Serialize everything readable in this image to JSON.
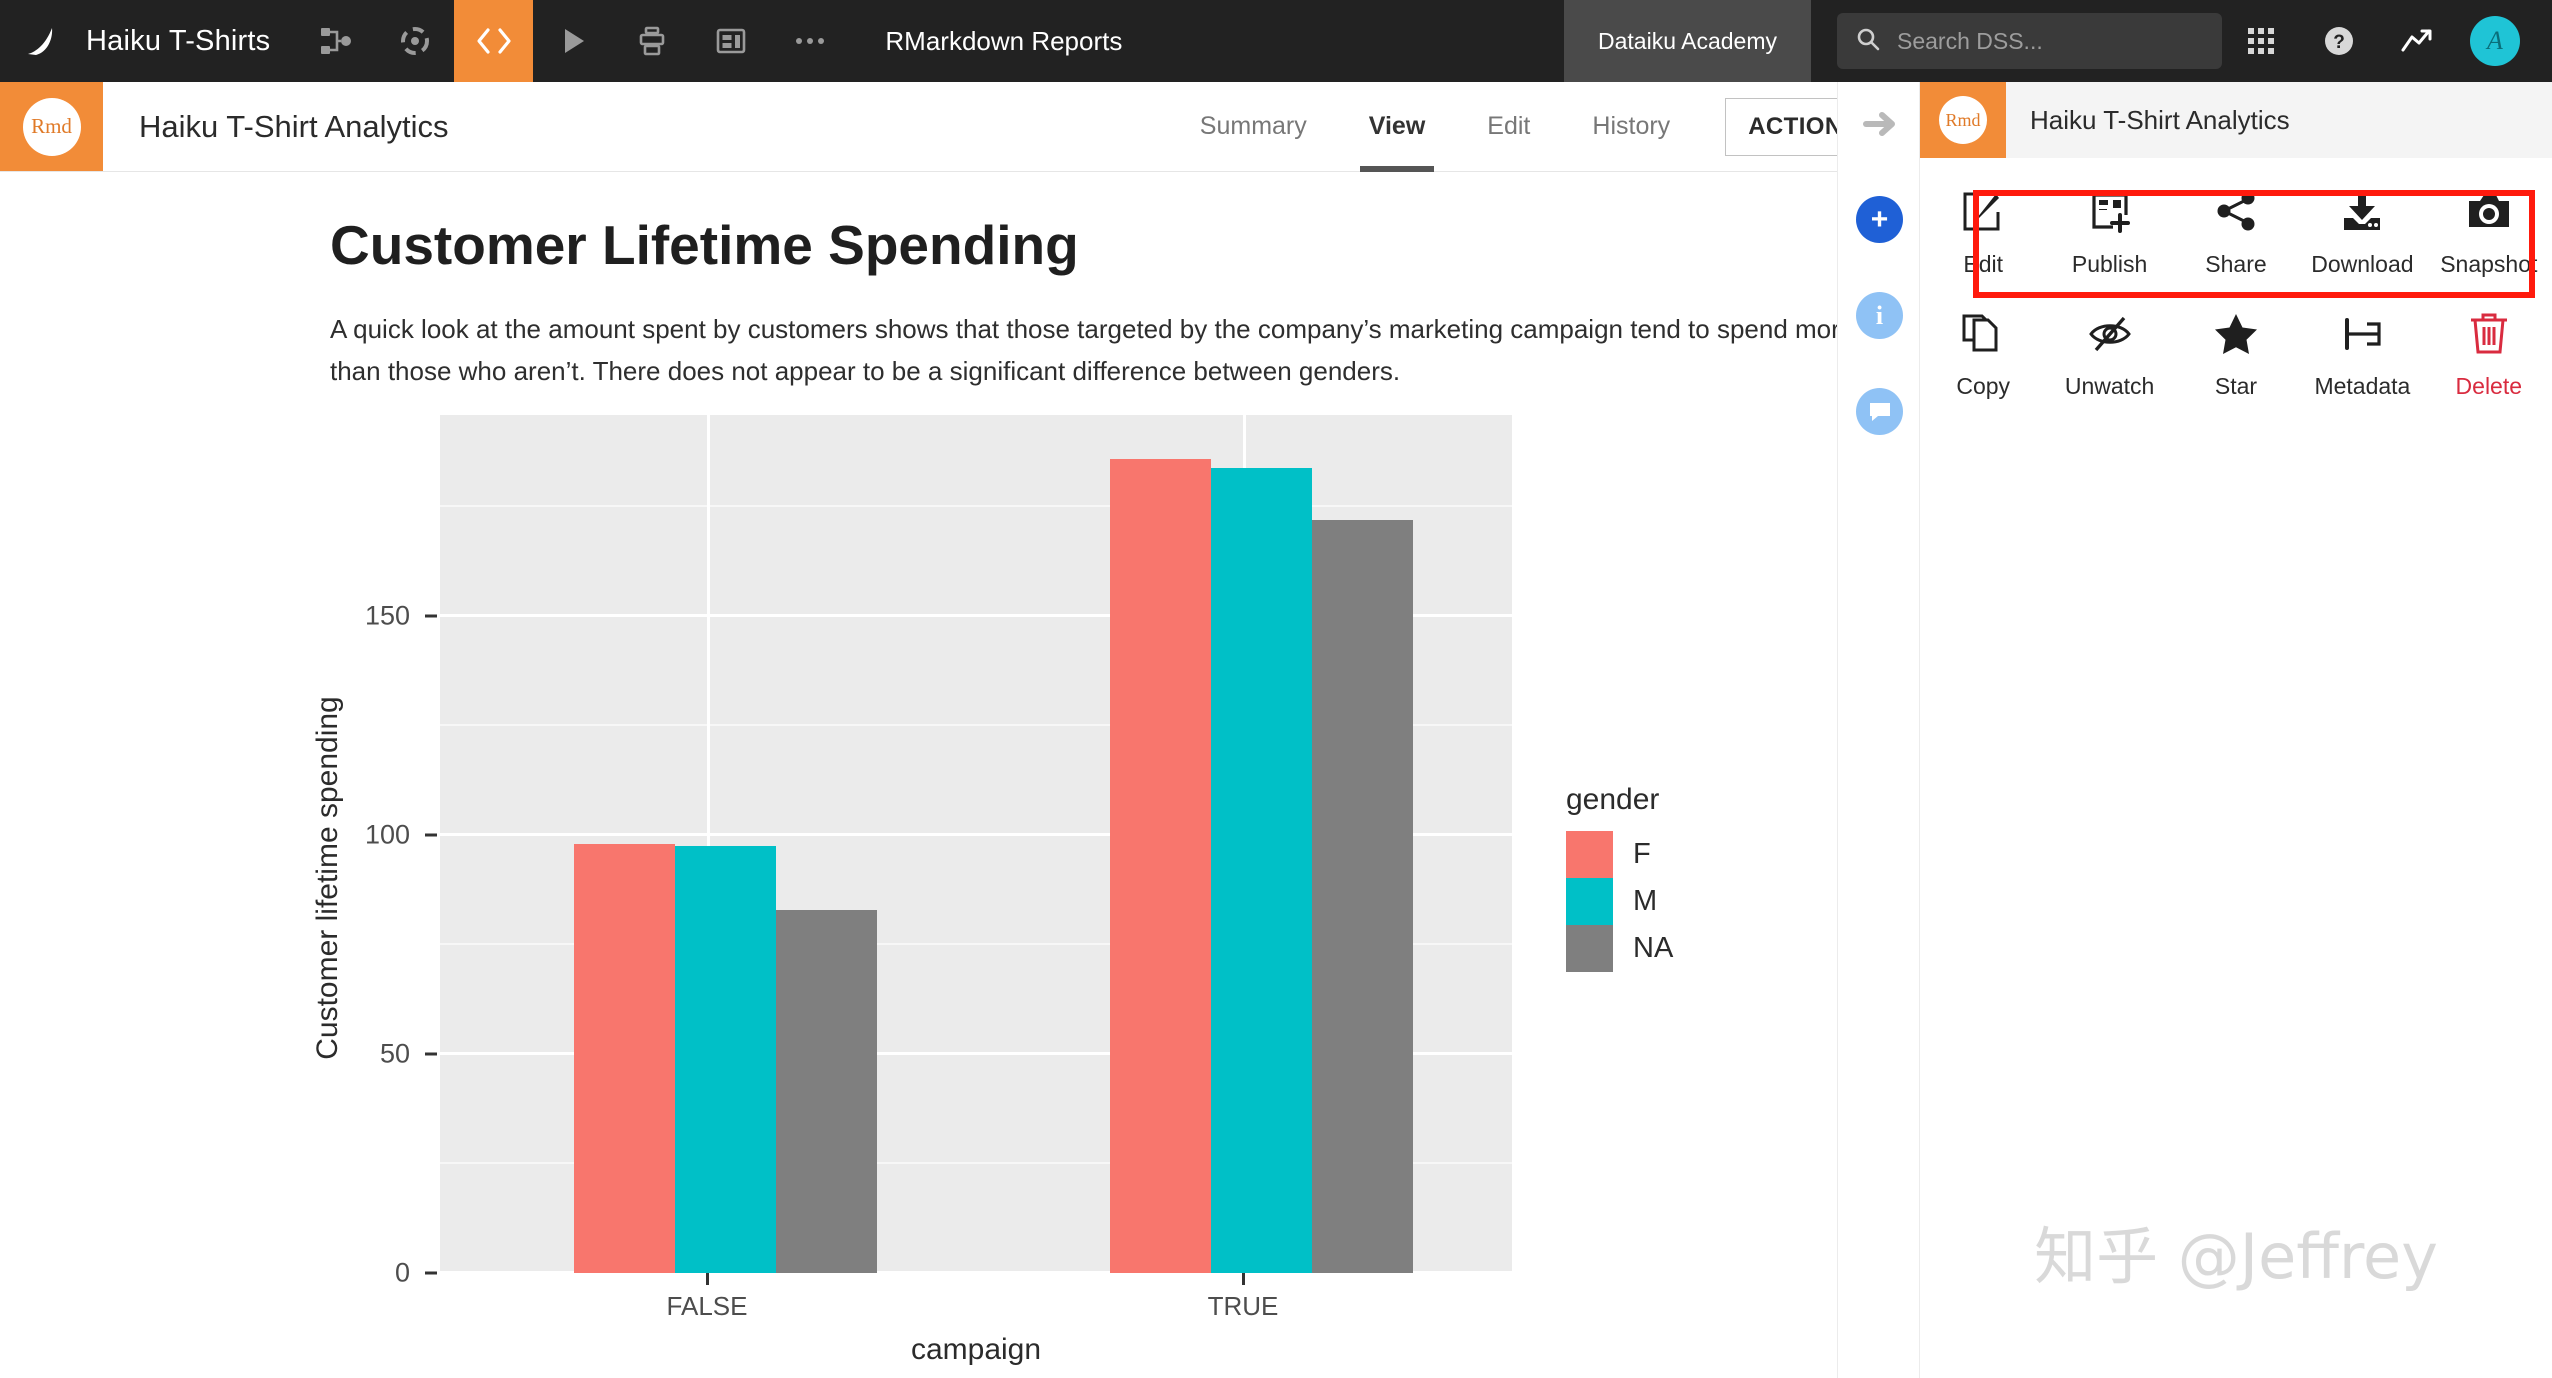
{
  "topbar": {
    "logo_icon": "dataiku-logo-icon",
    "project_name": "Haiku T-Shirts",
    "icons": [
      {
        "name": "flow-icon",
        "active": false
      },
      {
        "name": "lab-icon",
        "active": false
      },
      {
        "name": "code-icon",
        "active": true
      },
      {
        "name": "automation-run-icon",
        "active": false
      },
      {
        "name": "jobs-icon",
        "active": false
      },
      {
        "name": "dashboards-icon",
        "active": false
      },
      {
        "name": "more-icon",
        "active": false
      }
    ],
    "section_title": "RMarkdown Reports",
    "academy_label": "Dataiku Academy",
    "search_placeholder": "Search DSS...",
    "search_value": "",
    "right_icons": [
      "apps-grid-icon",
      "help-icon",
      "activity-icon"
    ],
    "avatar_initial": "A"
  },
  "subbar": {
    "badge_label": "Rmd",
    "title": "Haiku T-Shirt Analytics",
    "tabs": [
      {
        "label": "Summary",
        "active": false
      },
      {
        "label": "View",
        "active": true
      },
      {
        "label": "Edit",
        "active": false
      },
      {
        "label": "History",
        "active": false
      }
    ],
    "actions_label": "ACTIONS"
  },
  "document": {
    "title": "Customer Lifetime Spending",
    "paragraph": "A quick look at the amount spent by customers shows that those targeted by the company’s marketing campaign tend to spend more than those who aren’t. There does not appear to be a significant difference between genders."
  },
  "rail": {
    "items": [
      {
        "name": "collapse-panel-arrow-icon",
        "glyph": "→",
        "style": "arrow"
      },
      {
        "name": "add-icon",
        "glyph": "+",
        "style": "solid-blue"
      },
      {
        "name": "info-icon",
        "glyph": "i",
        "style": "light-blue"
      },
      {
        "name": "discussions-icon",
        "glyph": "●",
        "style": "light-blue"
      }
    ],
    "colors": {
      "arrow": "#b9b9b9",
      "solid_blue": "#1f60d6",
      "light_blue": "#8fc2f5"
    }
  },
  "right_panel": {
    "badge_label": "Rmd",
    "title": "Haiku T-Shirt Analytics",
    "highlight_color": "#ff1a0d",
    "actions": [
      {
        "label": "Edit",
        "icon": "edit-pencil-square-icon",
        "danger": false
      },
      {
        "label": "Publish",
        "icon": "publish-add-to-dashboard-icon",
        "danger": false
      },
      {
        "label": "Share",
        "icon": "share-nodes-icon",
        "danger": false
      },
      {
        "label": "Download",
        "icon": "download-icon",
        "danger": false
      },
      {
        "label": "Snapshot",
        "icon": "camera-snapshot-icon",
        "danger": false
      },
      {
        "label": "Copy",
        "icon": "copy-duplicate-icon",
        "danger": false
      },
      {
        "label": "Unwatch",
        "icon": "eye-slash-unwatch-icon",
        "danger": false
      },
      {
        "label": "Star",
        "icon": "star-icon",
        "danger": false
      },
      {
        "label": "Metadata",
        "icon": "metadata-tag-icon",
        "danger": false
      },
      {
        "label": "Delete",
        "icon": "trash-delete-icon",
        "danger": true
      }
    ],
    "watermark": "知乎 @Jeffrey"
  },
  "chart_data": {
    "type": "bar",
    "title": "",
    "xlabel": "campaign",
    "ylabel": "Customer lifetime spending",
    "categories": [
      "FALSE",
      "TRUE"
    ],
    "series": [
      {
        "name": "F",
        "color": "#f8766d",
        "values": [
          98,
          186
        ]
      },
      {
        "name": "M",
        "color": "#00c0c7",
        "values": [
          97.5,
          184
        ]
      },
      {
        "name": "NA",
        "color": "#7f7f7f",
        "values": [
          83,
          172
        ]
      }
    ],
    "legend_title": "gender",
    "legend_position": "right",
    "ylim": [
      0,
      196
    ],
    "yticks": [
      0,
      50,
      100,
      150
    ],
    "yminor": [
      25,
      75,
      125,
      175
    ],
    "grid": true,
    "panel_bg": "#ebebeb",
    "grid_color": "#ffffff"
  }
}
